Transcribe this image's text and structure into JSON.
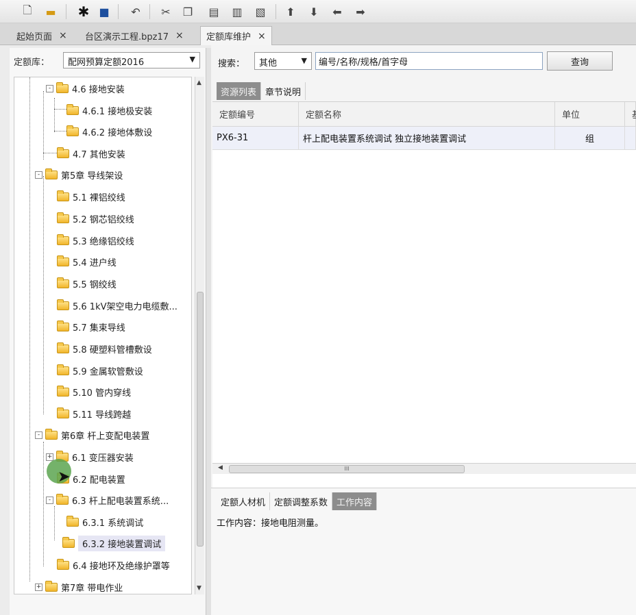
{
  "toolbar": {
    "icons": [
      "new-file-icon",
      "open-folder-icon",
      "settings-gear-icon",
      "save-icon",
      "undo-icon",
      "cut-icon",
      "copy-icon",
      "paste-icon",
      "delete-icon",
      "export-icon",
      "move-up-icon",
      "move-down-icon",
      "move-left-icon",
      "move-right-icon"
    ]
  },
  "tabs": [
    {
      "label": "起始页面",
      "close": "×"
    },
    {
      "label": "台区演示工程.bpz17",
      "close": "×"
    },
    {
      "label": "定额库维护",
      "close": "×"
    }
  ],
  "left": {
    "lib_label": "定额库：",
    "lib_value": "配网预算定额2016",
    "tree": [
      {
        "label": "4.6 接地安装",
        "expander": "-"
      },
      {
        "label": "4.6.1 接地极安装"
      },
      {
        "label": "4.6.2 接地体敷设"
      },
      {
        "label": "4.7 其他安装"
      },
      {
        "label": "第5章 导线架设",
        "expander": "-"
      },
      {
        "label": "5.1 裸铝绞线"
      },
      {
        "label": "5.2 钢芯铝绞线"
      },
      {
        "label": "5.3 绝缘铝绞线"
      },
      {
        "label": "5.4 进户线"
      },
      {
        "label": "5.5 钢绞线"
      },
      {
        "label": "5.6 1kV架空电力电缆敷..."
      },
      {
        "label": "5.7 集束导线"
      },
      {
        "label": "5.8 硬塑料管槽敷设"
      },
      {
        "label": "5.9 金属软管敷设"
      },
      {
        "label": "5.10 管内穿线"
      },
      {
        "label": "5.11 导线跨越"
      },
      {
        "label": "第6章 杆上变配电装置",
        "expander": "-"
      },
      {
        "label": "6.1 变压器安装",
        "expander": "+"
      },
      {
        "label": "6.2 配电装置"
      },
      {
        "label": "6.3 杆上配电装置系统...",
        "expander": "-"
      },
      {
        "label": "6.3.1 系统调试"
      },
      {
        "label": "6.3.2 接地装置调试"
      },
      {
        "label": "6.4 接地环及绝缘护罩等"
      },
      {
        "label": "第7章 带电作业",
        "expander": "+"
      }
    ]
  },
  "search": {
    "label": "搜索：",
    "type_value": "其他",
    "input_value": "编号/名称/规格/首字母",
    "query_label": "查询"
  },
  "subtabs_top": [
    "资源列表",
    "章节说明"
  ],
  "grid": {
    "headers": [
      "定额编号",
      "定额名称",
      "单位",
      "基"
    ],
    "rows": [
      {
        "code": "PX6-31",
        "name": "杆上配电装置系统调试 独立接地装置调试",
        "unit": "组",
        "extra": ""
      }
    ],
    "hscroll_grip": "III"
  },
  "subtabs_bottom": [
    "定额人材机",
    "定额调整系数",
    "工作内容"
  ],
  "work_content": "工作内容：接地电阻测量。",
  "colors": {
    "accent_tab": "#8d8d8d",
    "row_highlight": "#eef0f9",
    "selected_node": "#e6e6f4"
  }
}
